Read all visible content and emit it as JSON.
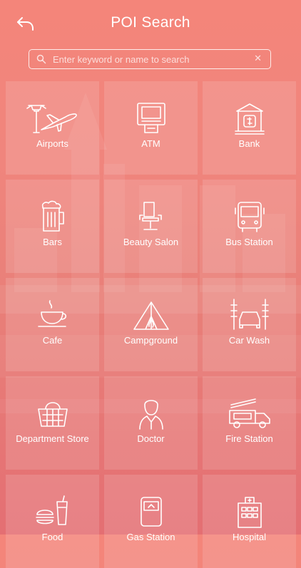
{
  "header": {
    "title": "POI Search"
  },
  "search": {
    "placeholder": "Enter keyword or name to search",
    "value": ""
  },
  "categories": [
    {
      "label": "Airports",
      "icon": "airport-tower-plane-icon"
    },
    {
      "label": "ATM",
      "icon": "atm-machine-icon"
    },
    {
      "label": "Bank",
      "icon": "bank-building-icon"
    },
    {
      "label": "Bars",
      "icon": "beer-mug-icon"
    },
    {
      "label": "Beauty Salon",
      "icon": "salon-chair-icon"
    },
    {
      "label": "Bus Station",
      "icon": "bus-icon"
    },
    {
      "label": "Cafe",
      "icon": "coffee-cup-icon"
    },
    {
      "label": "Campground",
      "icon": "tent-icon"
    },
    {
      "label": "Car Wash",
      "icon": "car-wash-icon"
    },
    {
      "label": "Department Store",
      "icon": "shopping-basket-icon"
    },
    {
      "label": "Doctor",
      "icon": "doctor-icon"
    },
    {
      "label": "Fire Station",
      "icon": "fire-truck-icon"
    },
    {
      "label": "Food",
      "icon": "burger-drink-icon"
    },
    {
      "label": "Gas Station",
      "icon": "gas-pump-icon"
    },
    {
      "label": "Hospital",
      "icon": "hospital-building-icon"
    }
  ]
}
